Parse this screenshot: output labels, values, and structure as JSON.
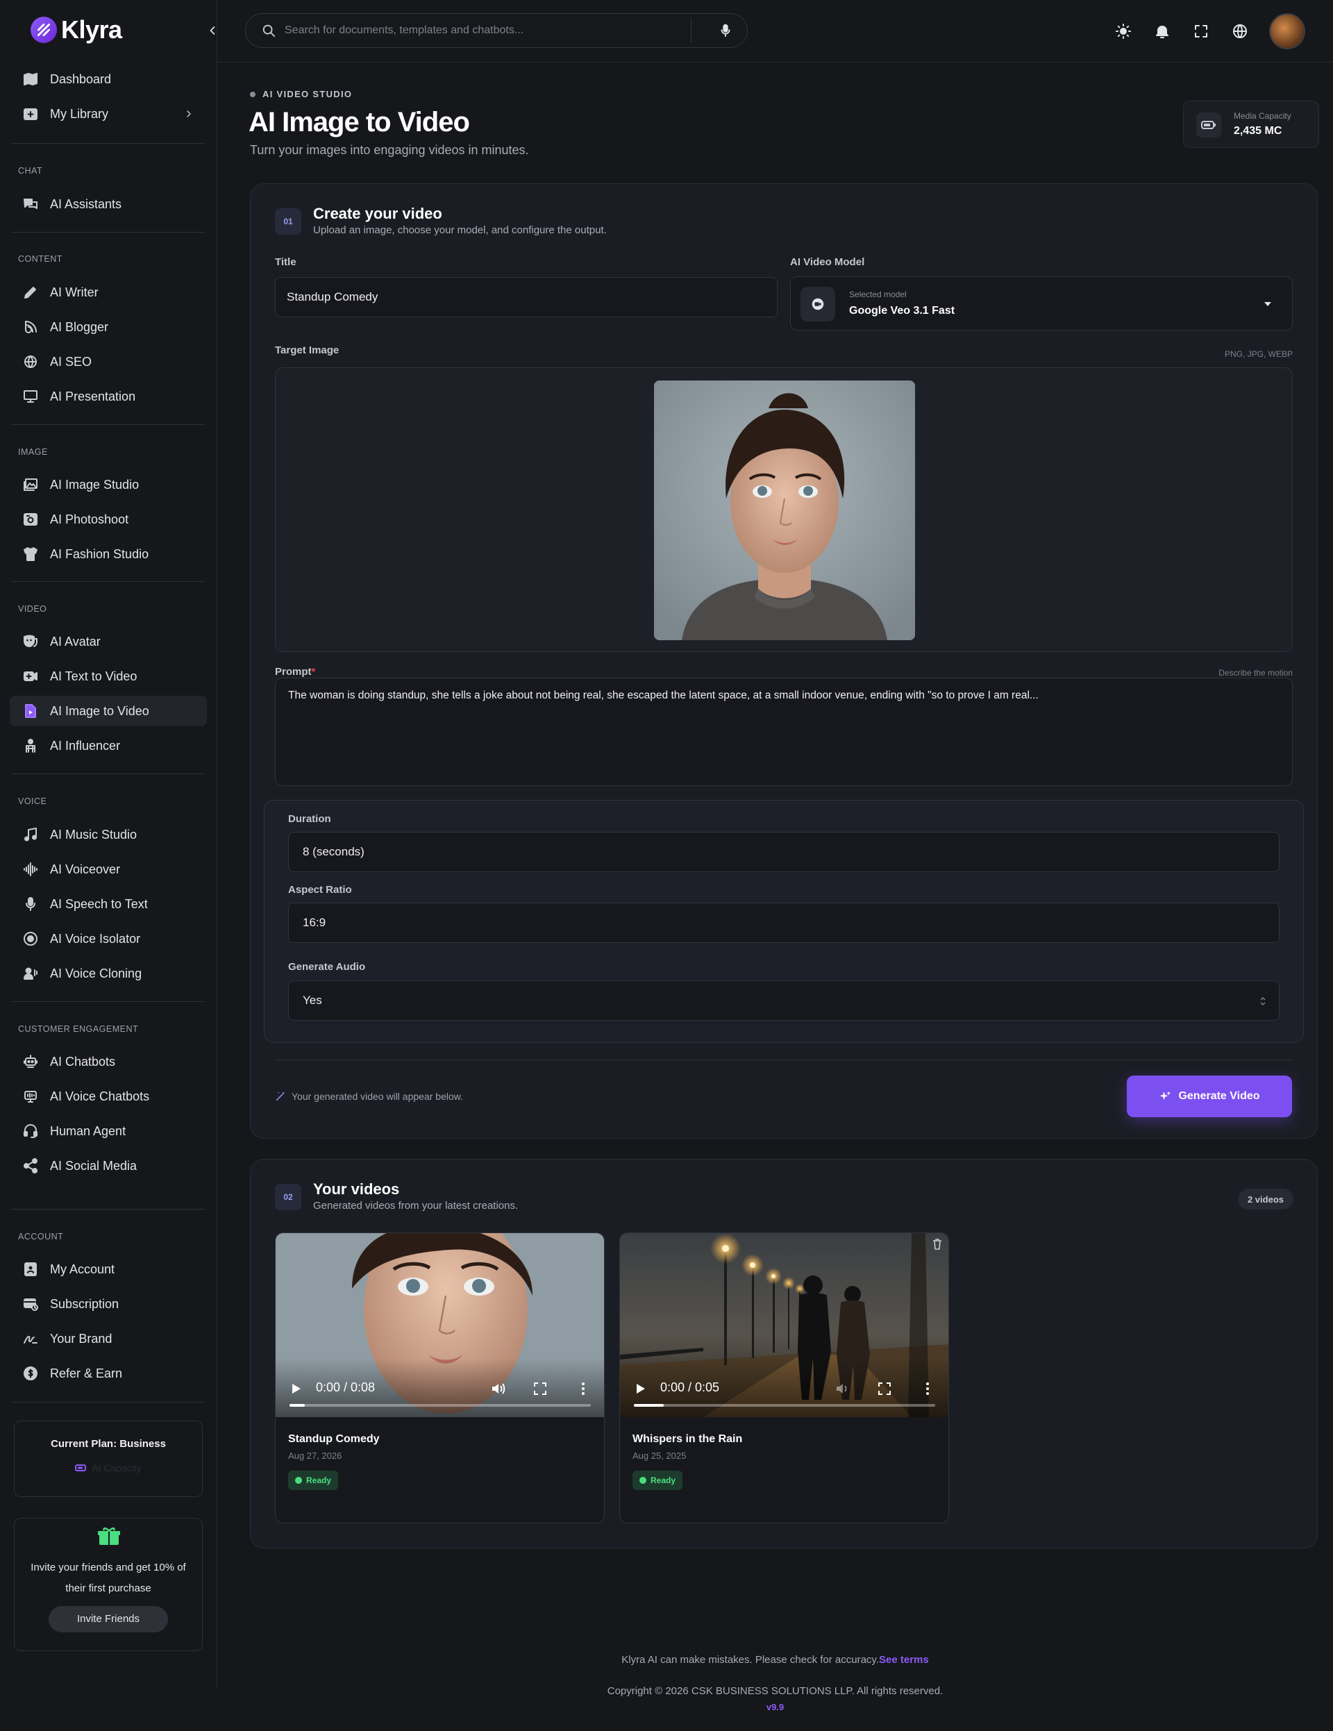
{
  "brand": {
    "name": "Klyra"
  },
  "search": {
    "placeholder": "Search for documents, templates and chatbots..."
  },
  "sidebar": {
    "top": [
      {
        "label": "Dashboard",
        "icon": "map-icon"
      },
      {
        "label": "My Library",
        "icon": "library-icon"
      }
    ],
    "sections": [
      {
        "title": "CHAT",
        "items": [
          {
            "label": "AI Assistants",
            "icon": "chat-icon"
          }
        ]
      },
      {
        "title": "CONTENT",
        "items": [
          {
            "label": "AI Writer",
            "icon": "pen-icon"
          },
          {
            "label": "AI Blogger",
            "icon": "blog-icon"
          },
          {
            "label": "AI SEO",
            "icon": "seo-icon"
          },
          {
            "label": "AI Presentation",
            "icon": "presentation-icon"
          }
        ]
      },
      {
        "title": "IMAGE",
        "items": [
          {
            "label": "AI Image Studio",
            "icon": "image-icon"
          },
          {
            "label": "AI Photoshoot",
            "icon": "camera-icon"
          },
          {
            "label": "AI Fashion Studio",
            "icon": "shirt-icon"
          }
        ]
      },
      {
        "title": "VIDEO",
        "items": [
          {
            "label": "AI Avatar",
            "icon": "mask-icon"
          },
          {
            "label": "AI Text to Video",
            "icon": "video-plus-icon"
          },
          {
            "label": "AI Image to Video",
            "icon": "file-video-icon",
            "active": true
          },
          {
            "label": "AI Influencer",
            "icon": "influencer-icon"
          }
        ]
      },
      {
        "title": "VOICE",
        "items": [
          {
            "label": "AI Music Studio",
            "icon": "music-icon"
          },
          {
            "label": "AI Voiceover",
            "icon": "waveform-icon"
          },
          {
            "label": "AI Speech to Text",
            "icon": "microphone-icon"
          },
          {
            "label": "AI Voice Isolator",
            "icon": "isolator-icon"
          },
          {
            "label": "AI Voice Cloning",
            "icon": "voice-clone-icon"
          }
        ]
      },
      {
        "title": "CUSTOMER ENGAGEMENT",
        "items": [
          {
            "label": "AI Chatbots",
            "icon": "robot-icon"
          },
          {
            "label": "AI Voice Chatbots",
            "icon": "voice-bot-icon"
          },
          {
            "label": "Human Agent",
            "icon": "headset-icon"
          },
          {
            "label": "AI Social Media",
            "icon": "share-icon"
          }
        ]
      },
      {
        "title": "ACCOUNT",
        "items": [
          {
            "label": "My Account",
            "icon": "account-icon"
          },
          {
            "label": "Subscription",
            "icon": "subscription-icon"
          },
          {
            "label": "Your Brand",
            "icon": "brand-icon"
          },
          {
            "label": "Refer & Earn",
            "icon": "refer-icon"
          }
        ]
      }
    ],
    "plan": {
      "title": "Current Plan: Business",
      "capacity_label": "AI Capacity"
    },
    "invite": {
      "text": "Invite your friends and get 10% of their first purchase",
      "button": "Invite Friends"
    }
  },
  "header": {
    "eyebrow": "AI VIDEO STUDIO",
    "title": "AI Image to Video",
    "subtitle": "Turn your images into engaging videos in minutes.",
    "capacity": {
      "label": "Media Capacity",
      "value": "2,435 MC"
    }
  },
  "create": {
    "step": "01",
    "title": "Create your video",
    "subtitle": "Upload an image, choose your model, and configure the output.",
    "title_label": "Title",
    "title_value": "Standup Comedy",
    "model_label": "AI Video Model",
    "model_caption": "Selected model",
    "model_value": "Google Veo 3.1 Fast",
    "image_label": "Target Image",
    "image_formats": "PNG, JPG, WEBP",
    "prompt_label": "Prompt",
    "prompt_hint": "Describe the motion",
    "prompt_value": "The woman is doing standup, she tells a joke about not being real, she escaped the latent space, at a small indoor venue, ending with \"so to prove I am real...",
    "duration_label": "Duration",
    "duration_value": "8 (seconds)",
    "aspect_label": "Aspect Ratio",
    "aspect_value": "16:9",
    "audio_label": "Generate Audio",
    "audio_value": "Yes",
    "footer_note": "Your generated video will appear below.",
    "generate_button": "Generate Video"
  },
  "videos": {
    "step": "02",
    "title": "Your videos",
    "subtitle": "Generated videos from your latest creations.",
    "count": "2 videos",
    "items": [
      {
        "title": "Standup Comedy",
        "date": "Aug 27, 2026",
        "time": "0:00 / 0:08",
        "status": "Ready",
        "progress": 0.05
      },
      {
        "title": "Whispers in the Rain",
        "date": "Aug 25, 2025",
        "time": "0:00 / 0:05",
        "status": "Ready",
        "progress": 0.1
      }
    ]
  },
  "footer": {
    "disclaimer": "Klyra AI can make mistakes. Please check for accuracy.",
    "terms_link": "See terms",
    "copyright": "Copyright © 2026 CSK BUSINESS SOLUTIONS LLP. All rights reserved.",
    "version": "v9.9"
  },
  "colors": {
    "accent": "#7c4ff0",
    "ready": "#4ade80",
    "background": "#16171b",
    "card": "#1b1d24"
  }
}
